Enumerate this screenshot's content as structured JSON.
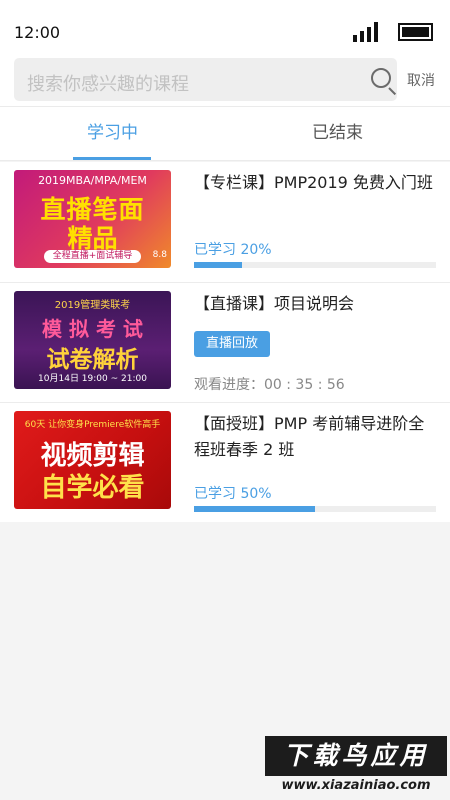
{
  "status_bar": {
    "time": "12:00"
  },
  "search": {
    "placeholder": "搜索你感兴趣的课程",
    "cancel_label": "取消"
  },
  "tabs": [
    {
      "label": "学习中",
      "active": true
    },
    {
      "label": "已结束",
      "active": false
    }
  ],
  "courses": [
    {
      "title": "【专栏课】PMP2019 免费入门班",
      "progress_text": "已学习 20%",
      "progress": 0.2,
      "thumb": {
        "line1": "2019MBA/MPA/MEM",
        "line2": "直播笔面",
        "line3": "精品",
        "line4": "全程直播+面试辅导",
        "badge": "8.8"
      }
    },
    {
      "title": "【直播课】项目说明会",
      "button": "直播回放",
      "watch_text": "观看进度：00 : 35 : 56",
      "thumb": {
        "line1": "2019管理类联考",
        "line2": "模 拟 考 试",
        "line3": "试卷解析",
        "line4": "10月14日 19:00 ~ 21:00"
      }
    },
    {
      "title": "【面授班】PMP  考前辅导进阶全程班春季 2 班",
      "progress_text": "已学习 50%",
      "progress": 0.5,
      "thumb": {
        "line1": "60天 让你变身Premiere软件高手",
        "line2": "视频剪辑",
        "line3": "自学必看"
      }
    }
  ],
  "watermark": {
    "title": "下载鸟应用",
    "url": "www.xiazainiao.com"
  },
  "colors": {
    "accent": "#4a9fe3",
    "background": "#f4f4f4"
  }
}
